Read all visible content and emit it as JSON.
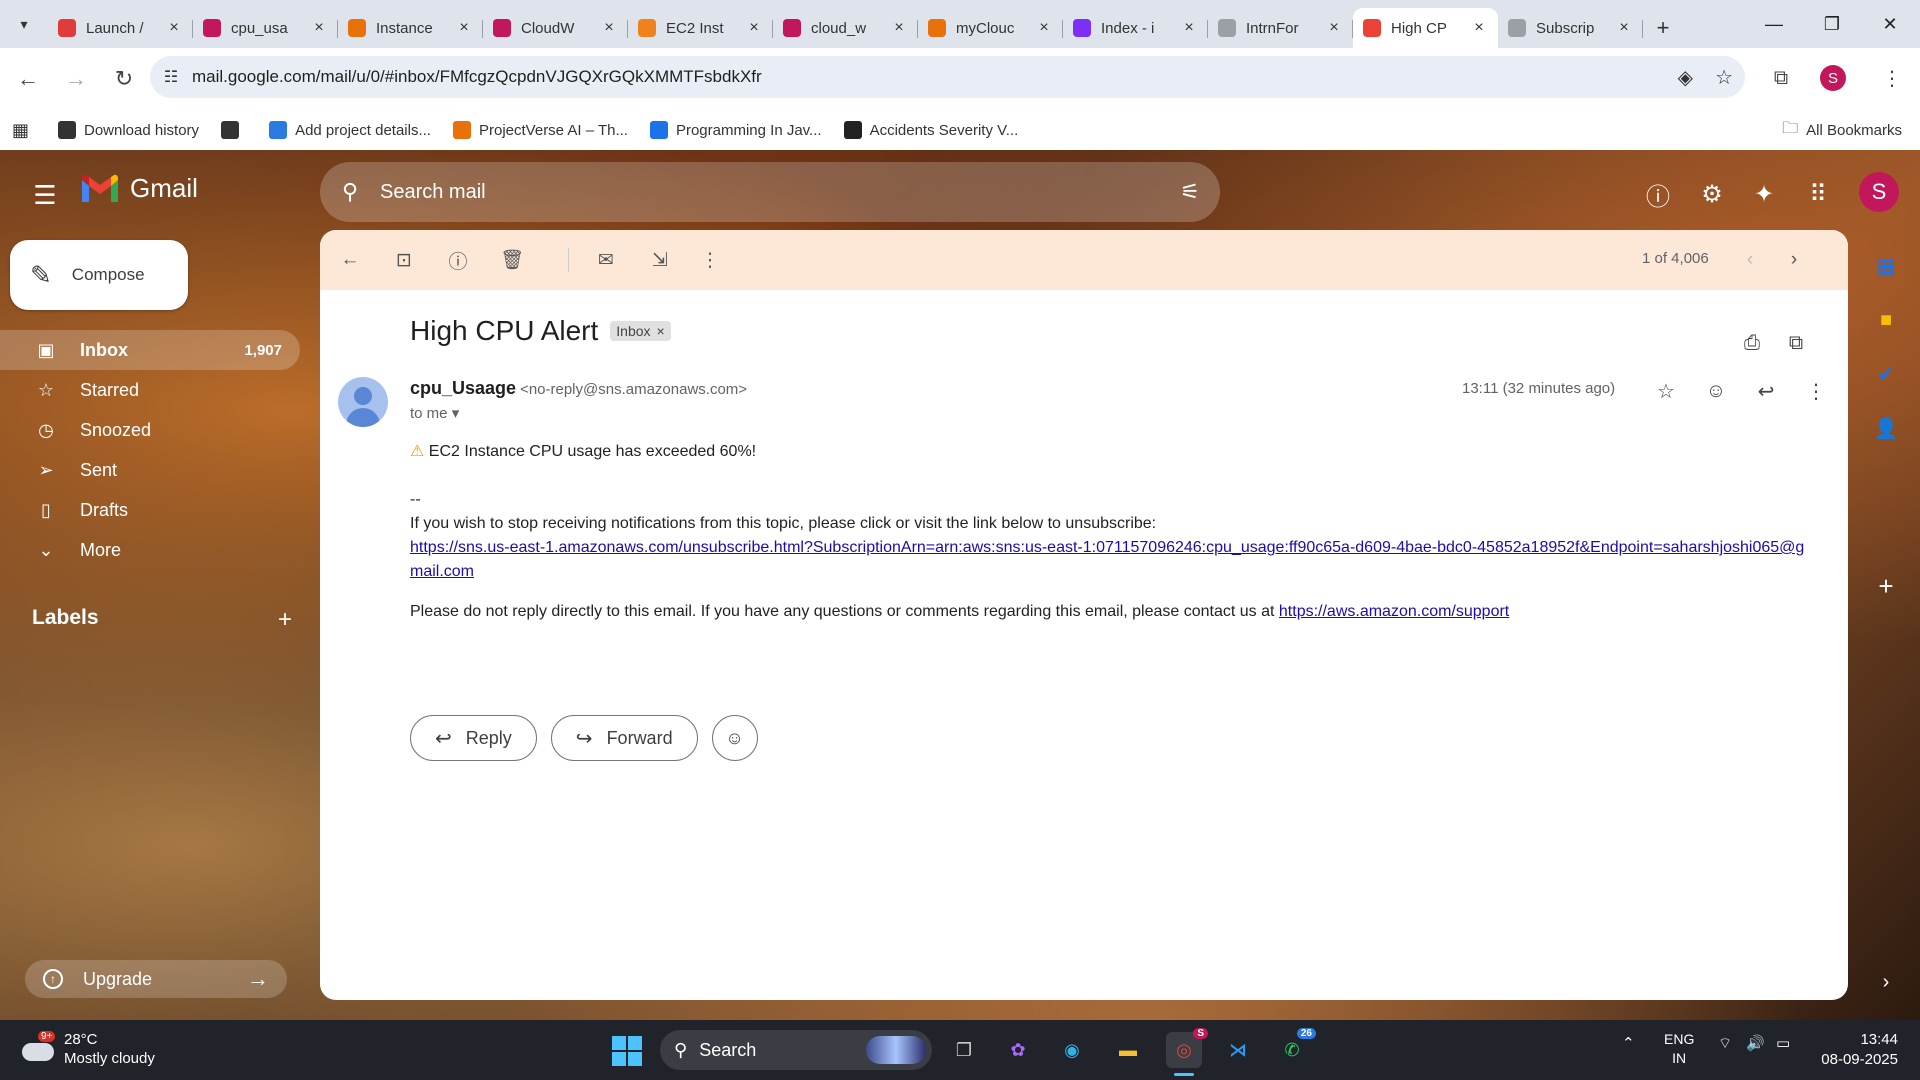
{
  "browser": {
    "tabs": [
      {
        "title": "Launch /",
        "favicon_color": "#e23b3b",
        "active": false
      },
      {
        "title": "cpu_usa",
        "favicon_color": "#c2185b",
        "active": false
      },
      {
        "title": "Instance",
        "favicon_color": "#e8710a",
        "active": false
      },
      {
        "title": "CloudW",
        "favicon_color": "#c2185b",
        "active": false
      },
      {
        "title": "EC2 Inst",
        "favicon_color": "#f0821e",
        "active": false
      },
      {
        "title": "cloud_w",
        "favicon_color": "#c2185b",
        "active": false
      },
      {
        "title": "myClouc",
        "favicon_color": "#e8710a",
        "active": false
      },
      {
        "title": "Index - i",
        "favicon_color": "#7b2ff7",
        "active": false
      },
      {
        "title": "IntrnFor",
        "favicon_color": "#9aa0a6",
        "active": false
      },
      {
        "title": "High CP",
        "favicon_color": "#ea4335",
        "active": true
      },
      {
        "title": "Subscrip",
        "favicon_color": "#9aa0a6",
        "active": false
      }
    ],
    "url": "mail.google.com/mail/u/0/#inbox/FMfcgzQcpdnVJGQXrGQkXMMTFsbdkXfr",
    "profile_initial": "S",
    "bookmarks": [
      {
        "label": "Download history",
        "icon": "download-icon",
        "color": "#333333"
      },
      {
        "label": "",
        "icon": "globe-icon",
        "color": "#333333"
      },
      {
        "label": "Add project details...",
        "icon": "form-icon",
        "color": "#2a7ae2"
      },
      {
        "label": "ProjectVerse AI – Th...",
        "icon": "projectverse-icon",
        "color": "#e8710a"
      },
      {
        "label": "Programming In Jav...",
        "icon": "s-icon",
        "color": "#1a73e8"
      },
      {
        "label": "Accidents Severity V...",
        "icon": "openai-icon",
        "color": "#222222"
      }
    ],
    "all_bookmarks_label": "All Bookmarks"
  },
  "gmail": {
    "app_name": "Gmail",
    "search_placeholder": "Search mail",
    "compose_label": "Compose",
    "nav": [
      {
        "label": "Inbox",
        "count": "1,907",
        "icon": "inbox-icon",
        "active": true
      },
      {
        "label": "Starred",
        "count": "",
        "icon": "star-icon",
        "active": false
      },
      {
        "label": "Snoozed",
        "count": "",
        "icon": "clock-icon",
        "active": false
      },
      {
        "label": "Sent",
        "count": "",
        "icon": "send-icon",
        "active": false
      },
      {
        "label": "Drafts",
        "count": "",
        "icon": "draft-icon",
        "active": false
      },
      {
        "label": "More",
        "count": "",
        "icon": "chevron-down-icon",
        "active": false
      }
    ],
    "labels_heading": "Labels",
    "upgrade_label": "Upgrade",
    "avatar_initial": "S"
  },
  "message": {
    "pagination": "1 of 4,006",
    "subject": "High CPU Alert",
    "label_chip": "Inbox",
    "sender_name": "cpu_Usaage",
    "sender_email": "<no-reply@sns.amazonaws.com>",
    "recipient": "to me",
    "time": "13:11 (32 minutes ago)",
    "body_alert": "EC2 Instance CPU usage has exceeded 60%!",
    "body_dashes": "--",
    "body_unsub_text": "If you wish to stop receiving notifications from this topic, please click or visit the link below to unsubscribe:",
    "body_unsub_link": "https://sns.us-east-1.amazonaws.com/unsubscribe.html?SubscriptionArn=arn:aws:sns:us-east-1:071157096246:cpu_usage:ff90c65a-d609-4bae-bdc0-45852a18952f&Endpoint=saharshjoshi065@gmail.com",
    "body_noreply_text": "Please do not reply directly to this email. If you have any questions or comments regarding this email, please contact us at",
    "body_support_link": "https://aws.amazon.com/support",
    "reply_label": "Reply",
    "forward_label": "Forward"
  },
  "taskbar": {
    "weather_temp": "28°C",
    "weather_desc": "Mostly cloudy",
    "weather_badge": "9+",
    "search_label": "Search",
    "chrome_badge": "S",
    "whatsapp_badge": "26",
    "lang_line1": "ENG",
    "lang_line2": "IN",
    "time": "13:44",
    "date": "08-09-2025"
  }
}
